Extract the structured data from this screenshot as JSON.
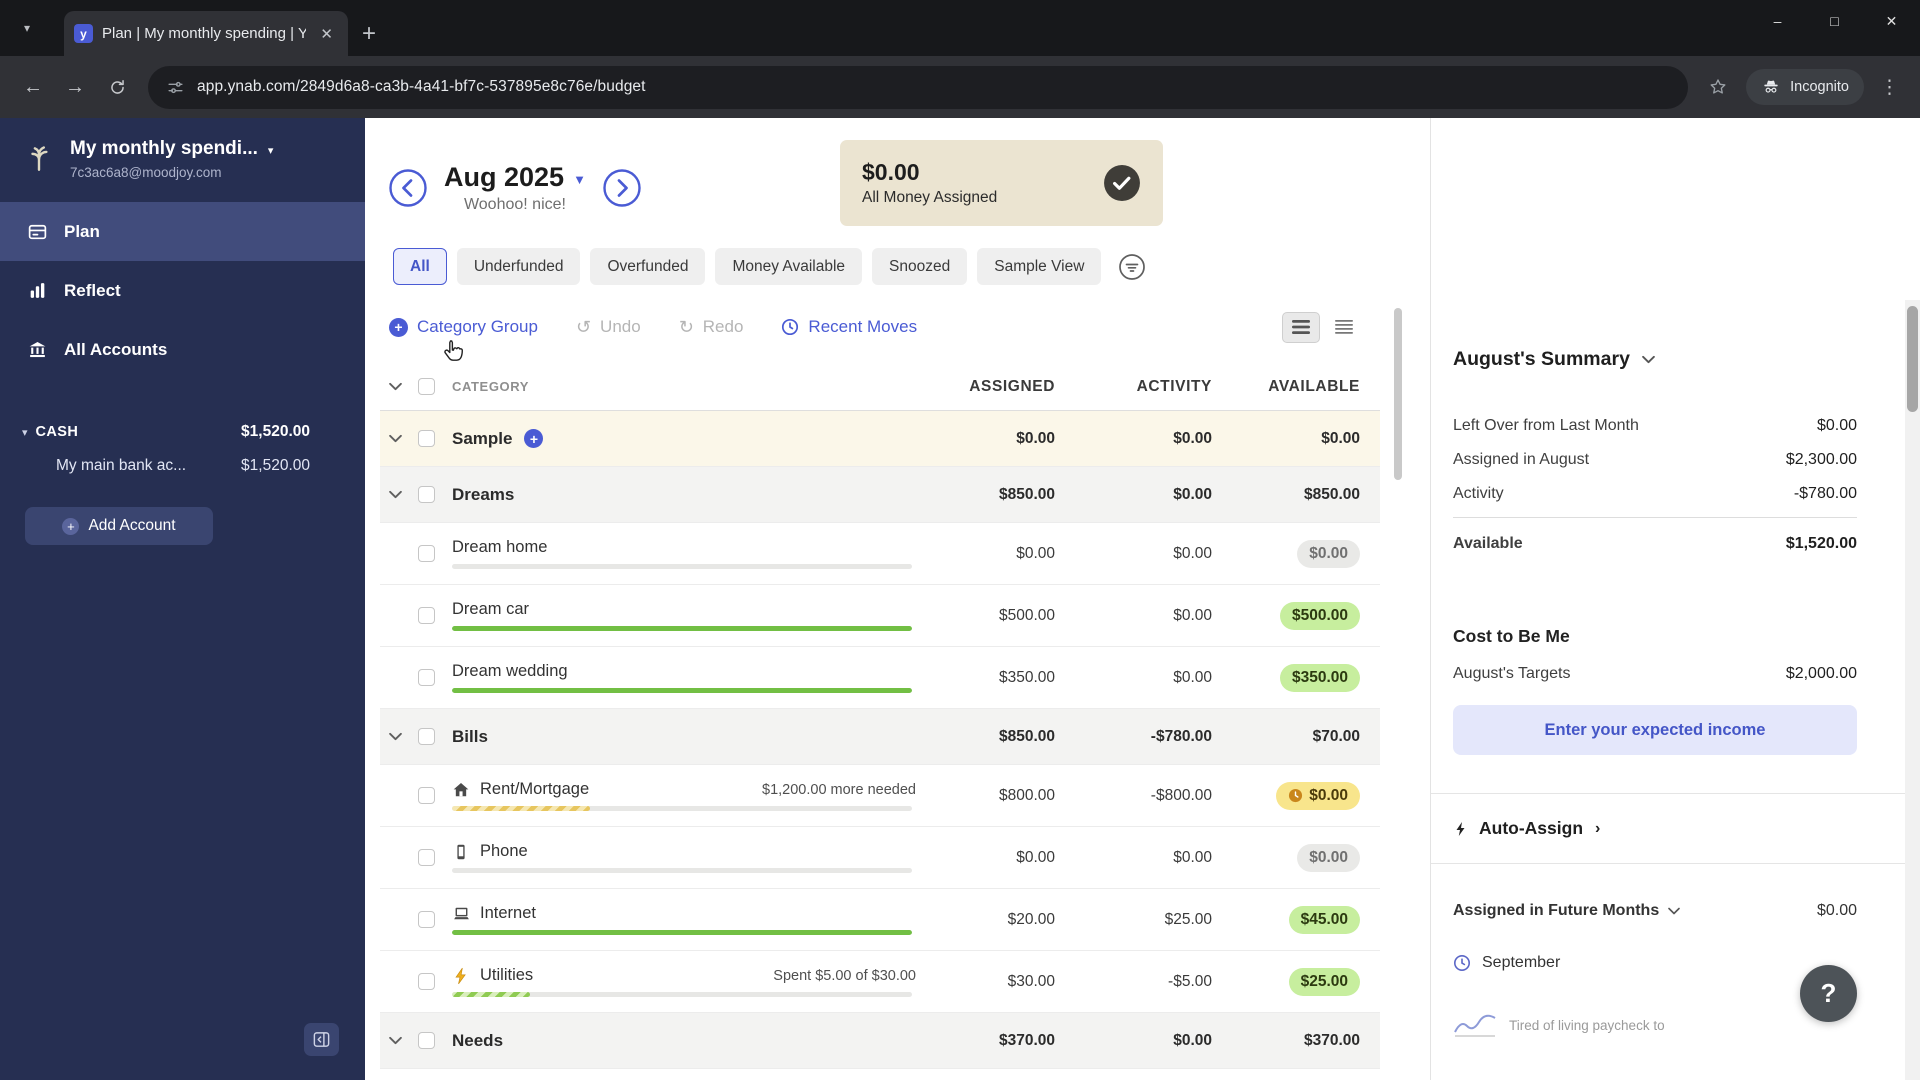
{
  "browser": {
    "tab_title": "Plan | My monthly spending | Y",
    "url": "app.ynab.com/2849d6a8-ca3b-4a41-bf7c-537895e8c76e/budget",
    "incognito_label": "Incognito"
  },
  "sidebar": {
    "budget_name": "My monthly spendi...",
    "email": "7c3ac6a8@moodjoy.com",
    "nav": [
      {
        "label": "Plan"
      },
      {
        "label": "Reflect"
      },
      {
        "label": "All Accounts"
      }
    ],
    "cash": {
      "label": "CASH",
      "amount": "$1,520.00"
    },
    "accounts": [
      {
        "name": "My main bank ac...",
        "amount": "$1,520.00"
      }
    ],
    "add_account_label": "Add Account"
  },
  "header": {
    "month": "Aug 2025",
    "subtitle": "Woohoo! nice!",
    "banner_amount": "$0.00",
    "banner_label": "All Money Assigned"
  },
  "filters": {
    "items": [
      "All",
      "Underfunded",
      "Overfunded",
      "Money Available",
      "Snoozed",
      "Sample View"
    ],
    "selected_index": 0
  },
  "toolbar": {
    "category_group": "Category Group",
    "undo": "Undo",
    "redo": "Redo",
    "recent_moves": "Recent Moves"
  },
  "table": {
    "headers": {
      "category": "CATEGORY",
      "assigned": "ASSIGNED",
      "activity": "ACTIVITY",
      "available": "AVAILABLE"
    },
    "rows": [
      {
        "type": "group",
        "name": "Sample",
        "assigned": "$0.00",
        "activity": "$0.00",
        "available": "$0.00",
        "has_add": true,
        "highlight": true
      },
      {
        "type": "group",
        "name": "Dreams",
        "assigned": "$850.00",
        "activity": "$0.00",
        "available": "$850.00"
      },
      {
        "type": "category",
        "name": "Dream home",
        "assigned": "$0.00",
        "activity": "$0.00",
        "available": "$0.00",
        "status": "zero",
        "progress": 0,
        "bar": "none"
      },
      {
        "type": "category",
        "name": "Dream car",
        "assigned": "$500.00",
        "activity": "$0.00",
        "available": "$500.00",
        "status": "funded",
        "progress": 100,
        "bar": "solid"
      },
      {
        "type": "category",
        "name": "Dream wedding",
        "assigned": "$350.00",
        "activity": "$0.00",
        "available": "$350.00",
        "status": "funded",
        "progress": 100,
        "bar": "solid"
      },
      {
        "type": "group",
        "name": "Bills",
        "assigned": "$850.00",
        "activity": "-$780.00",
        "available": "$70.00"
      },
      {
        "type": "category",
        "name": "Rent/Mortgage",
        "icon": "house",
        "note": "$1,200.00 more needed",
        "assigned": "$800.00",
        "activity": "-$800.00",
        "available": "$0.00",
        "status": "caution",
        "progress": 30,
        "bar": "striped-caution"
      },
      {
        "type": "category",
        "name": "Phone",
        "icon": "phone",
        "assigned": "$0.00",
        "activity": "$0.00",
        "available": "$0.00",
        "status": "zero",
        "progress": 0,
        "bar": "none"
      },
      {
        "type": "category",
        "name": "Internet",
        "icon": "laptop",
        "assigned": "$20.00",
        "activity": "$25.00",
        "available": "$45.00",
        "status": "funded",
        "progress": 100,
        "bar": "solid"
      },
      {
        "type": "category",
        "name": "Utilities",
        "icon": "bolt",
        "note": "Spent $5.00 of $30.00",
        "assigned": "$30.00",
        "activity": "-$5.00",
        "available": "$25.00",
        "status": "funded",
        "progress": 17,
        "bar": "striped-funded"
      },
      {
        "type": "group",
        "name": "Needs",
        "assigned": "$370.00",
        "activity": "$0.00",
        "available": "$370.00"
      }
    ]
  },
  "summary": {
    "title": "August's Summary",
    "rows": [
      {
        "label": "Left Over from Last Month",
        "value": "$0.00"
      },
      {
        "label": "Assigned in August",
        "value": "$2,300.00"
      },
      {
        "label": "Activity",
        "value": "-$780.00"
      }
    ],
    "available_label": "Available",
    "available_value": "$1,520.00",
    "cost_title": "Cost to Be Me",
    "targets_label": "August's Targets",
    "targets_value": "$2,000.00",
    "income_button": "Enter your expected income",
    "auto_assign": "Auto-Assign",
    "future_label": "Assigned in Future Months",
    "future_value": "$0.00",
    "future_month": "September",
    "teaser": "Tired of living paycheck to"
  },
  "help": {
    "label": "?"
  },
  "colors": {
    "accent_blue": "#4a5bd4",
    "sidebar_bg": "#262f52",
    "banner_bg": "#ebe4d1",
    "pill_green_bg": "#c7ee9e",
    "pill_gray_bg": "#e9e9e7",
    "pill_yellow_bg": "#f8e58c",
    "progress_green": "#72bf44"
  }
}
